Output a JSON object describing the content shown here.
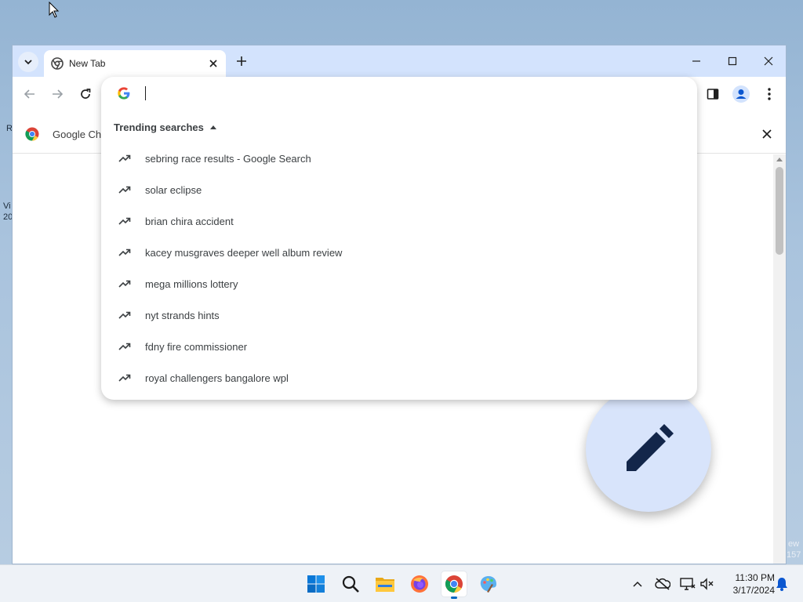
{
  "desktop": {
    "fragments": [
      "R",
      "Vi",
      "20",
      "ew",
      "157"
    ]
  },
  "browser": {
    "tab": {
      "title": "New Tab"
    },
    "infobar": {
      "text": "Google Ch"
    },
    "omnibox": {
      "value": "",
      "trending_header": "Trending searches",
      "suggestions": [
        "sebring race results - Google Search",
        "solar eclipse",
        "brian chira accident",
        "kacey musgraves deeper well album review",
        "mega millions lottery",
        "nyt strands hints",
        "fdny fire commissioner",
        "royal challengers bangalore wpl"
      ]
    },
    "colors": {
      "tabbar": "#d3e3fd",
      "accent": "#0b57d0",
      "fab": "#d8e4fb"
    }
  },
  "taskbar": {
    "apps": [
      "start-icon",
      "search-icon",
      "file-explorer-icon",
      "firefox-icon",
      "chrome-icon",
      "paint-icon"
    ],
    "clock": {
      "time": "11:30 PM",
      "date": "3/17/2024"
    }
  }
}
